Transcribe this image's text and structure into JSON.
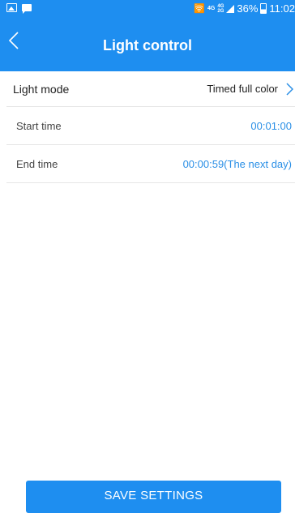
{
  "status_bar": {
    "network_1": "4G",
    "network_2a": "4G",
    "network_2b": "2G",
    "battery": "36%",
    "time": "11:02"
  },
  "header": {
    "title": "Light control"
  },
  "settings": {
    "light_mode": {
      "label": "Light mode",
      "value": "Timed full color"
    },
    "start_time": {
      "label": "Start time",
      "value": "00:01:00"
    },
    "end_time": {
      "label": "End time",
      "value": "00:00:59(The next day)"
    }
  },
  "actions": {
    "save_label": "SAVE SETTINGS"
  },
  "colors": {
    "primary": "#1e8ef0",
    "value_blue": "#2a8fe6",
    "divider": "#e6e6e6"
  },
  "icons": {
    "back": "chevron-left-icon",
    "mode_arrow": "chevron-right-icon"
  }
}
